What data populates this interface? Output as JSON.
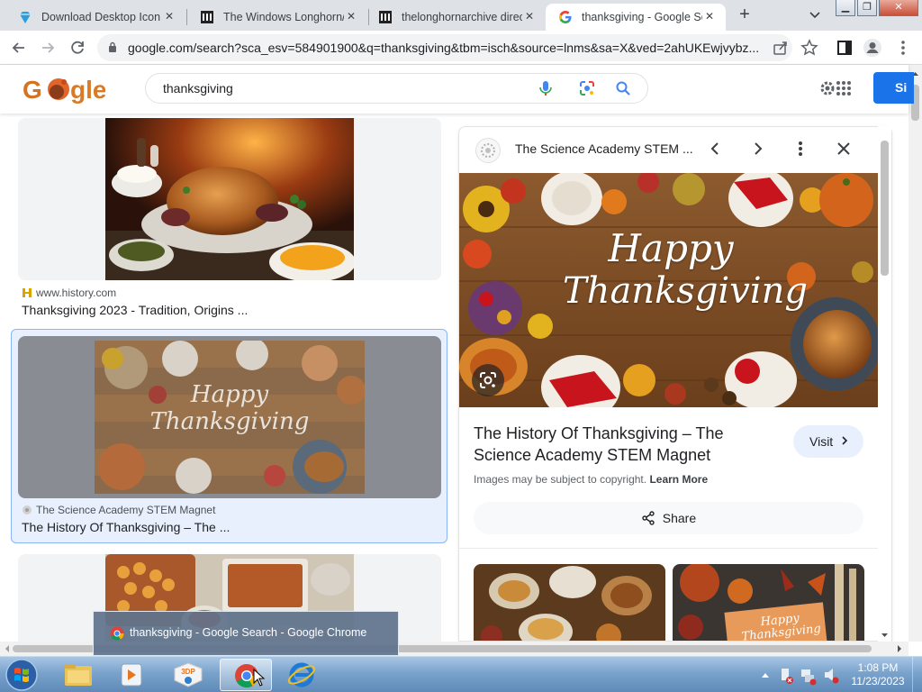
{
  "browser": {
    "tabs": [
      {
        "label": "Download Desktop Icon",
        "icon": "diamond-favicon-icon"
      },
      {
        "label": "The Windows Longhorn/",
        "icon": "archive-building-icon"
      },
      {
        "label": "thelonghornarchive direc",
        "icon": "archive-building-icon"
      },
      {
        "label": "thanksgiving - Google Se",
        "icon": "google-g-icon",
        "active": true
      }
    ],
    "new_tab": "+",
    "url": "google.com/search?sca_esv=584901900&q=thanksgiving&tbm=isch&source=lnms&sa=X&ved=2ahUKEwjvybz..."
  },
  "google": {
    "logo_text": "Google",
    "query": "thanksgiving",
    "signin_label": "Si"
  },
  "results": [
    {
      "source": "www.history.com",
      "title": "Thanksgiving 2023 - Tradition, Origins ..."
    },
    {
      "source": "The Science Academy STEM Magnet",
      "title": "The History Of Thanksgiving – The ...",
      "selected": true
    }
  ],
  "panel": {
    "site": "The Science Academy STEM ...",
    "image_text_line1": "Happy",
    "image_text_line2": "Thanksgiving",
    "title": "The History Of Thanksgiving – The Science Academy STEM Magnet",
    "visit_label": "Visit",
    "copyright_text": "Images may be subject to copyright.",
    "learn_more": "Learn More",
    "share_label": "Share",
    "related_text_line1": "Happy",
    "related_text_line2": "Thanksgiving"
  },
  "taskbar": {
    "time": "1:08 PM",
    "date": "11/23/2023",
    "tooltip": "thanksgiving - Google Search - Google Chrome"
  },
  "colors": {
    "accent_blue": "#1a73e8",
    "selected_card_bg": "#e8f0fe",
    "tabstrip_bg": "#dee1e6"
  }
}
